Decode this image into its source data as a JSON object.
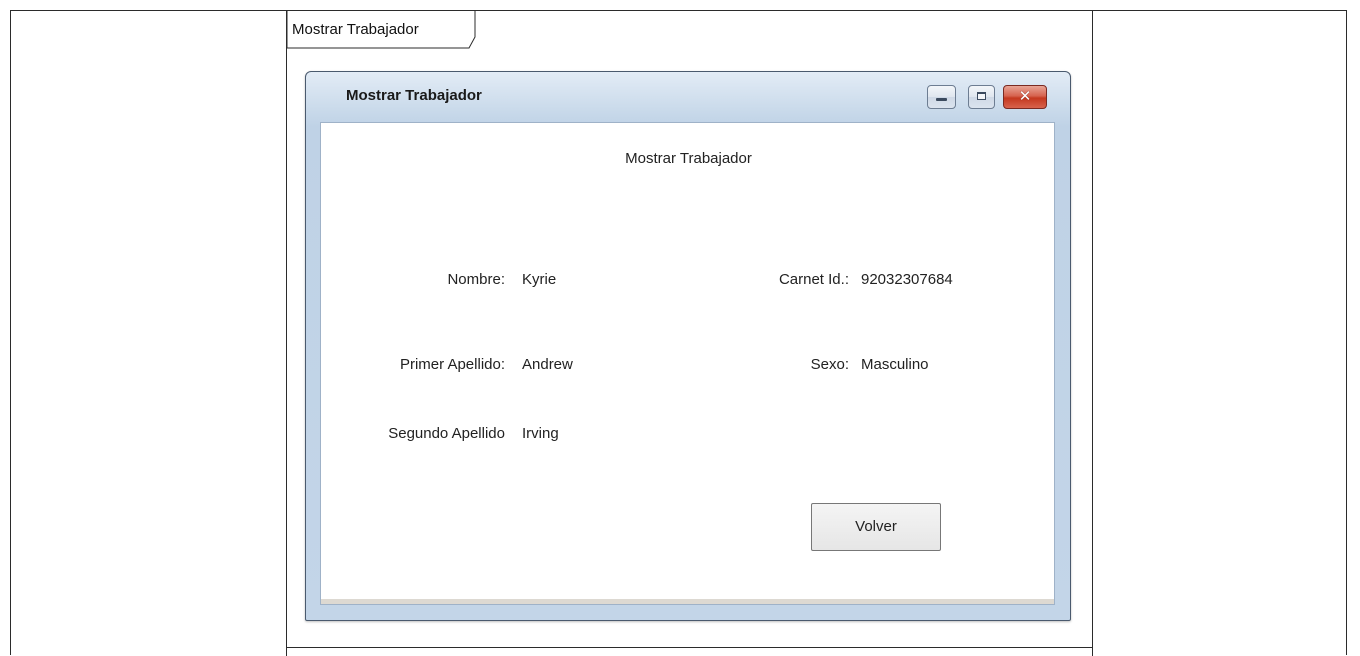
{
  "tab": {
    "label": "Mostrar Trabajador"
  },
  "window": {
    "title": "Mostrar Trabajador",
    "controls": {
      "minimize_icon": "minimize-icon",
      "maximize_icon": "maximize-icon",
      "close_icon": "close-icon",
      "close_glyph": "✕"
    }
  },
  "form": {
    "heading": "Mostrar Trabajador",
    "fields": {
      "nombre": {
        "label": "Nombre:",
        "value": "Kyrie"
      },
      "carnet": {
        "label": "Carnet Id.:",
        "value": "92032307684"
      },
      "primer_apellido": {
        "label": "Primer Apellido:",
        "value": "Andrew"
      },
      "sexo": {
        "label": "Sexo:",
        "value": "Masculino"
      },
      "segundo_apellido": {
        "label": "Segundo Apellido",
        "value": "Irving"
      }
    },
    "volver_label": "Volver"
  },
  "colors": {
    "window_frame": "#c3d5e8",
    "close_button": "#c4381f",
    "client_bg": "#ffffff"
  }
}
